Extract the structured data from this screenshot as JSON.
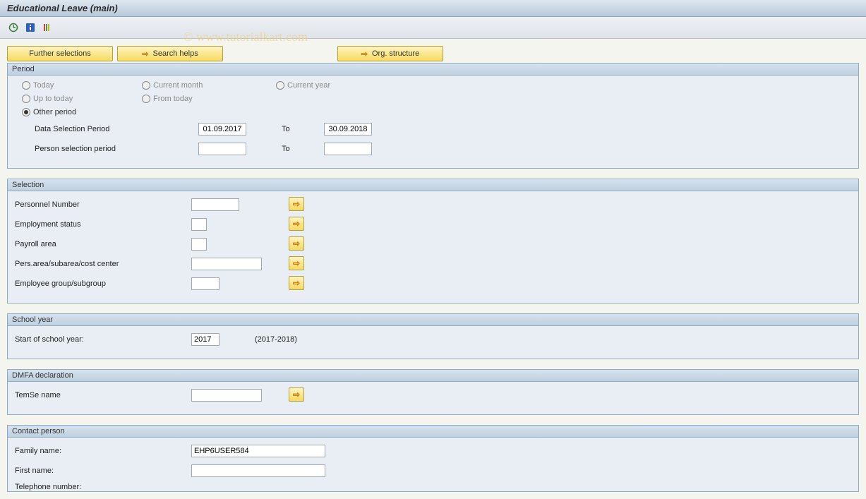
{
  "title": "Educational Leave (main)",
  "watermark": "© www.tutorialkart.com",
  "buttons": {
    "further_selections": "Further selections",
    "search_helps": "Search helps",
    "org_structure": "Org. structure"
  },
  "period": {
    "header": "Period",
    "today": "Today",
    "current_month": "Current month",
    "current_year": "Current year",
    "up_to_today": "Up to today",
    "from_today": "From today",
    "other_period": "Other period",
    "data_selection_label": "Data Selection Period",
    "person_selection_label": "Person selection period",
    "to_label": "To",
    "data_from": "01.09.2017",
    "data_to": "30.09.2018",
    "person_from": "",
    "person_to": ""
  },
  "selection": {
    "header": "Selection",
    "personnel_number": "Personnel Number",
    "employment_status": "Employment status",
    "payroll_area": "Payroll area",
    "pers_area": "Pers.area/subarea/cost center",
    "employee_group": "Employee group/subgroup"
  },
  "school_year": {
    "header": "School year",
    "label": "Start of school year:",
    "value": "2017",
    "range": "(2017-2018)"
  },
  "dmfa": {
    "header": "DMFA declaration",
    "temse_label": "TemSe name",
    "temse_value": ""
  },
  "contact": {
    "header": "Contact person",
    "family_name_label": "Family name:",
    "family_name_value": "EHP6USER584",
    "first_name_label": "First name:",
    "first_name_value": "",
    "telephone_label": "Telephone number:"
  }
}
